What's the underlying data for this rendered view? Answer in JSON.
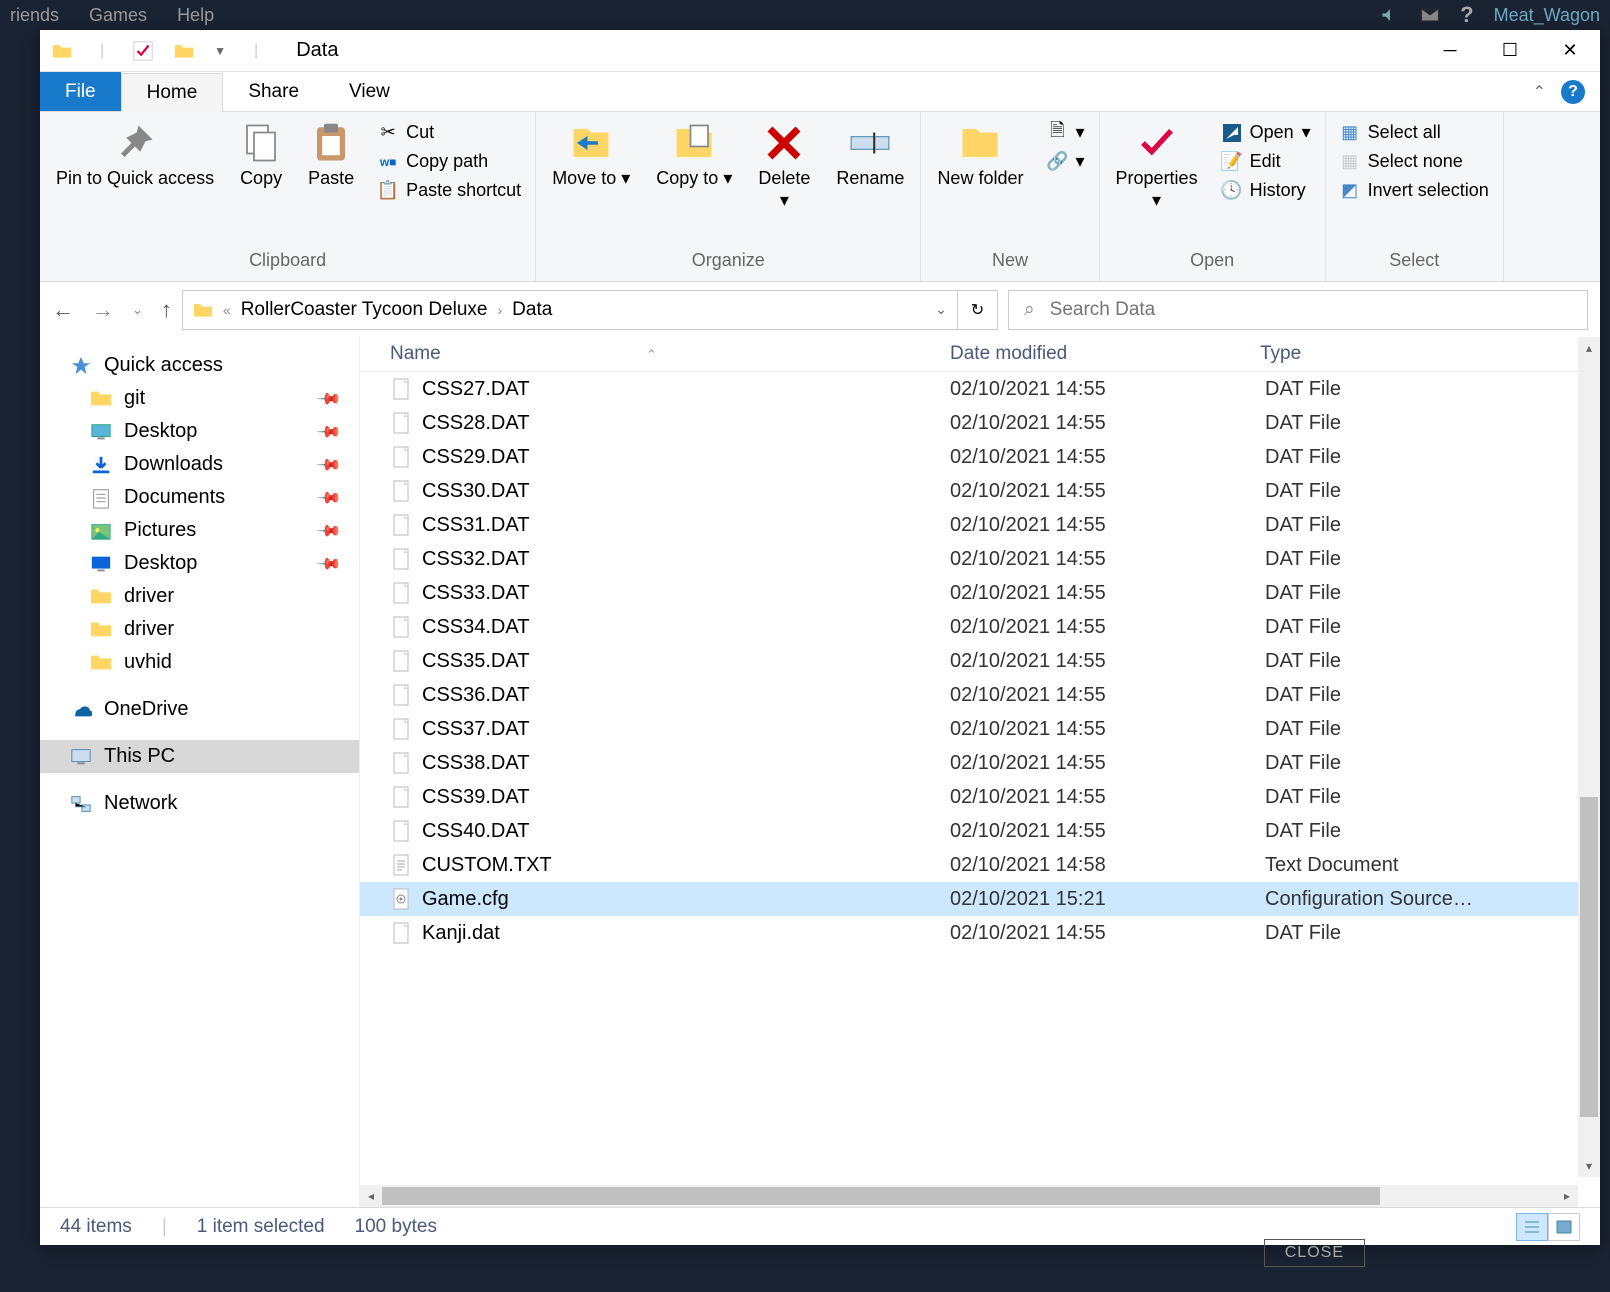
{
  "steam": {
    "menu": [
      "riends",
      "Games",
      "Help"
    ],
    "user": "Meat_Wagon",
    "close": "CLOSE"
  },
  "title": "Data",
  "tabs": {
    "file": "File",
    "home": "Home",
    "share": "Share",
    "view": "View"
  },
  "ribbon": {
    "clipboard": {
      "pin": "Pin to Quick access",
      "copy": "Copy",
      "paste": "Paste",
      "cut": "Cut",
      "copypath": "Copy path",
      "pasteshort": "Paste shortcut",
      "label": "Clipboard"
    },
    "organize": {
      "moveto": "Move to",
      "copyto": "Copy to",
      "delete": "Delete",
      "rename": "Rename",
      "label": "Organize"
    },
    "new": {
      "newfolder": "New folder",
      "label": "New"
    },
    "open": {
      "properties": "Properties",
      "open": "Open",
      "edit": "Edit",
      "history": "History",
      "label": "Open"
    },
    "select": {
      "all": "Select all",
      "none": "Select none",
      "invert": "Invert selection",
      "label": "Select"
    }
  },
  "breadcrumb": {
    "parent": "RollerCoaster Tycoon Deluxe",
    "current": "Data"
  },
  "search": {
    "placeholder": "Search Data"
  },
  "sidebar": {
    "quick": "Quick access",
    "items": [
      {
        "label": "git",
        "pin": true,
        "ico": "folder"
      },
      {
        "label": "Desktop",
        "pin": true,
        "ico": "desktop"
      },
      {
        "label": "Downloads",
        "pin": true,
        "ico": "download"
      },
      {
        "label": "Documents",
        "pin": true,
        "ico": "doc"
      },
      {
        "label": "Pictures",
        "pin": true,
        "ico": "pic"
      },
      {
        "label": "Desktop",
        "pin": true,
        "ico": "desktop2"
      },
      {
        "label": "driver",
        "pin": false,
        "ico": "folder"
      },
      {
        "label": "driver",
        "pin": false,
        "ico": "folder"
      },
      {
        "label": "uvhid",
        "pin": false,
        "ico": "folder"
      }
    ],
    "onedrive": "OneDrive",
    "thispc": "This PC",
    "network": "Network"
  },
  "columns": {
    "name": "Name",
    "date": "Date modified",
    "type": "Type"
  },
  "files": [
    {
      "name": "CSS27.DAT",
      "date": "02/10/2021 14:55",
      "type": "DAT File",
      "ico": "file"
    },
    {
      "name": "CSS28.DAT",
      "date": "02/10/2021 14:55",
      "type": "DAT File",
      "ico": "file"
    },
    {
      "name": "CSS29.DAT",
      "date": "02/10/2021 14:55",
      "type": "DAT File",
      "ico": "file"
    },
    {
      "name": "CSS30.DAT",
      "date": "02/10/2021 14:55",
      "type": "DAT File",
      "ico": "file"
    },
    {
      "name": "CSS31.DAT",
      "date": "02/10/2021 14:55",
      "type": "DAT File",
      "ico": "file"
    },
    {
      "name": "CSS32.DAT",
      "date": "02/10/2021 14:55",
      "type": "DAT File",
      "ico": "file"
    },
    {
      "name": "CSS33.DAT",
      "date": "02/10/2021 14:55",
      "type": "DAT File",
      "ico": "file"
    },
    {
      "name": "CSS34.DAT",
      "date": "02/10/2021 14:55",
      "type": "DAT File",
      "ico": "file"
    },
    {
      "name": "CSS35.DAT",
      "date": "02/10/2021 14:55",
      "type": "DAT File",
      "ico": "file"
    },
    {
      "name": "CSS36.DAT",
      "date": "02/10/2021 14:55",
      "type": "DAT File",
      "ico": "file"
    },
    {
      "name": "CSS37.DAT",
      "date": "02/10/2021 14:55",
      "type": "DAT File",
      "ico": "file"
    },
    {
      "name": "CSS38.DAT",
      "date": "02/10/2021 14:55",
      "type": "DAT File",
      "ico": "file"
    },
    {
      "name": "CSS39.DAT",
      "date": "02/10/2021 14:55",
      "type": "DAT File",
      "ico": "file"
    },
    {
      "name": "CSS40.DAT",
      "date": "02/10/2021 14:55",
      "type": "DAT File",
      "ico": "file"
    },
    {
      "name": "CUSTOM.TXT",
      "date": "02/10/2021 14:58",
      "type": "Text Document",
      "ico": "text"
    },
    {
      "name": "Game.cfg",
      "date": "02/10/2021 15:21",
      "type": "Configuration Source…",
      "ico": "cfg",
      "selected": true
    },
    {
      "name": "Kanji.dat",
      "date": "02/10/2021 14:55",
      "type": "DAT File",
      "ico": "file"
    }
  ],
  "status": {
    "count": "44 items",
    "selected": "1 item selected",
    "size": "100 bytes"
  }
}
